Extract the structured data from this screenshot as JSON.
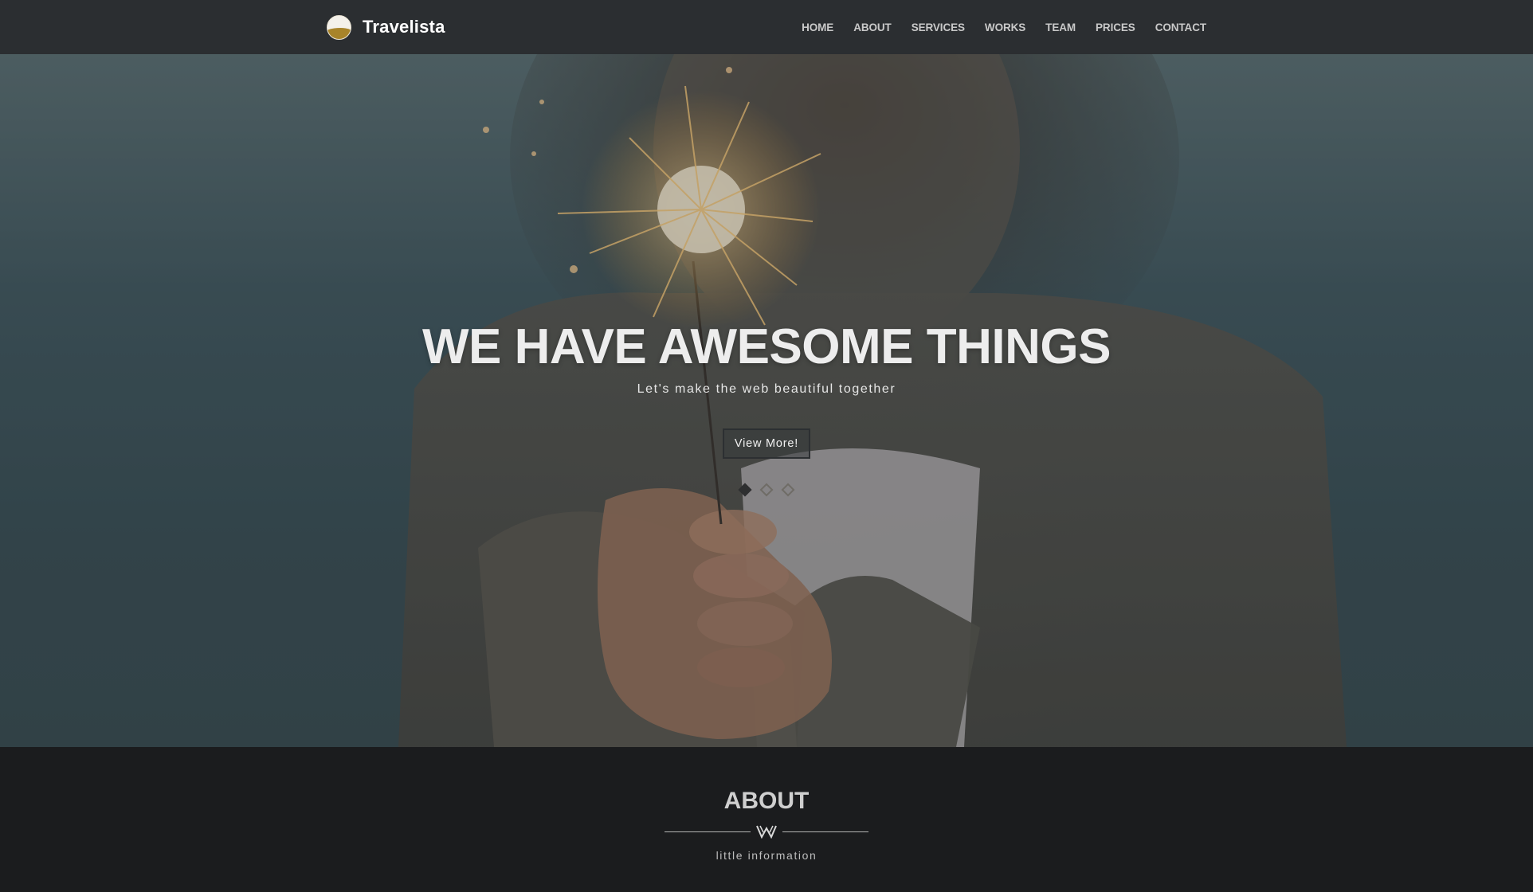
{
  "brand": {
    "name": "Travelista",
    "logo_icon": "sun-wave-logo-icon"
  },
  "nav": {
    "items": [
      {
        "label": "HOME"
      },
      {
        "label": "ABOUT"
      },
      {
        "label": "SERVICES"
      },
      {
        "label": "WORKS"
      },
      {
        "label": "TEAM"
      },
      {
        "label": "PRICES"
      },
      {
        "label": "CONTACT"
      }
    ]
  },
  "hero": {
    "title": "WE HAVE AWESOME THINGS",
    "subtitle": "Let's make the web beautiful together",
    "button_label": "View More!",
    "slides_total": 3,
    "active_slide": 1
  },
  "about": {
    "title": "ABOUT",
    "subtitle": "little information",
    "divider_icon": "w-ornament-icon"
  },
  "colors": {
    "navbar_bg": "#2b2e31",
    "section_bg": "#1b1c1e",
    "hero_text": "#ededed",
    "nav_text": "#c9c9c9",
    "logo_gold": "#a8842a"
  }
}
